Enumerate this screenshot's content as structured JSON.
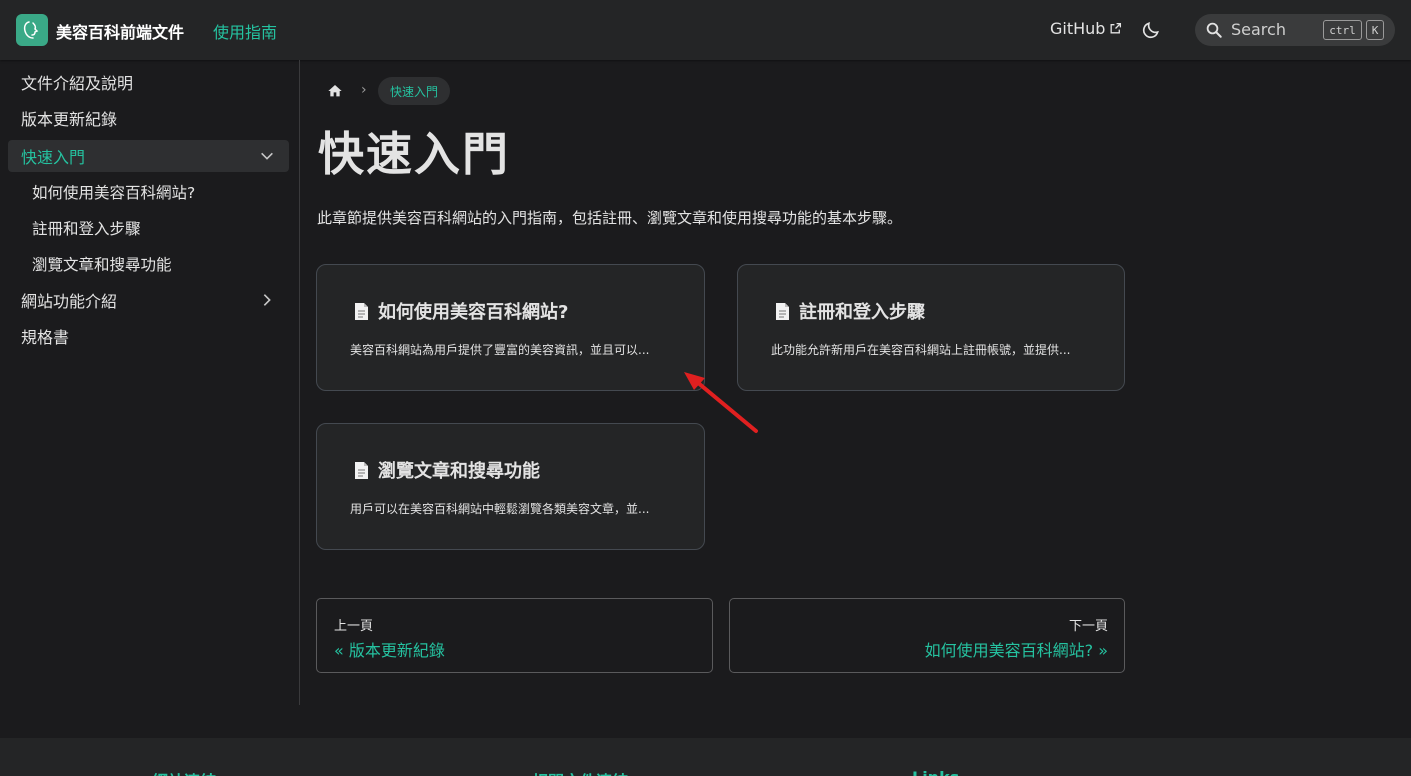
{
  "navbar": {
    "brand": "美容百科前端文件",
    "guide_link": "使用指南",
    "github_link": "GitHub",
    "search_label": "Search",
    "search_kbd_ctrl": "ctrl",
    "search_kbd_k": "K"
  },
  "sidebar": {
    "items": [
      {
        "label": "文件介紹及說明"
      },
      {
        "label": "版本更新紀錄"
      },
      {
        "label": "快速入門"
      },
      {
        "label": "如何使用美容百科網站?"
      },
      {
        "label": "註冊和登入步驟"
      },
      {
        "label": "瀏覽文章和搜尋功能"
      },
      {
        "label": "網站功能介紹"
      },
      {
        "label": "規格書"
      }
    ]
  },
  "breadcrumb": {
    "current": "快速入門"
  },
  "main": {
    "title": "快速入門",
    "description": "此章節提供美容百科網站的入門指南，包括註冊、瀏覽文章和使用搜尋功能的基本步驟。",
    "cards": [
      {
        "title": "如何使用美容百科網站?",
        "desc": "美容百科網站為用戶提供了豐富的美容資訊，並且可以..."
      },
      {
        "title": "註冊和登入步驟",
        "desc": "此功能允許新用戶在美容百科網站上註冊帳號，並提供..."
      },
      {
        "title": "瀏覽文章和搜尋功能",
        "desc": "用戶可以在美容百科網站中輕鬆瀏覽各類美容文章，並..."
      }
    ]
  },
  "pagination": {
    "prev_sub": "上一頁",
    "prev_label": "« 版本更新紀錄",
    "next_sub": "下一頁",
    "next_label": "如何使用美容百科網站? »"
  },
  "footer": {
    "columns": [
      "網站連結",
      "相關文件連結",
      "Links"
    ]
  },
  "colors": {
    "accent": "#25c2a0",
    "background": "#1b1b1d",
    "surface": "#242526",
    "annotation_arrow": "#e02020"
  }
}
